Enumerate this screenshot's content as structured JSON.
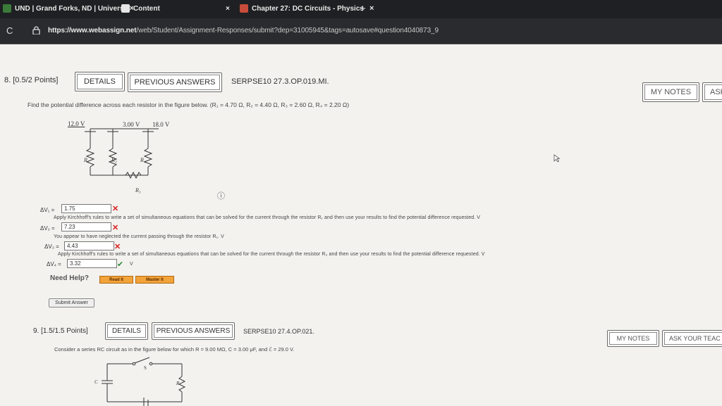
{
  "browser": {
    "tabs": [
      {
        "label": "UND | Grand Forks, ND | Univers",
        "close": "×"
      },
      {
        "label": "Content",
        "close": "×"
      },
      {
        "label": "Chapter 27: DC Circuits - Physics",
        "close": "×"
      }
    ],
    "new_tab": "+",
    "reload": "C",
    "url_host": "https://www.webassign.net",
    "url_path": "/web/Student/Assignment-Responses/submit?dep=31005945&tags=autosave#question4040873_9"
  },
  "q8": {
    "number": "8. [0.5/2 Points]",
    "details": "DETAILS",
    "previous_answers": "PREVIOUS ANSWERS",
    "code": "SERPSE10 27.3.OP.019.MI.",
    "my_notes": "MY NOTES",
    "ask": "ASK",
    "prompt": "Find the potential difference across each resistor in the figure below. (R₁ = 4.70 Ω, R₂ = 4.40 Ω, R₃ = 2.60 Ω, R₄ = 2.20 Ω)",
    "figure": {
      "v1": "12.0 V",
      "v2": "3.00 V",
      "v3": "18.0 V",
      "r1": "R₁",
      "r2": "R₂",
      "r3": "R₃",
      "r4": "R₄"
    },
    "info_icon": "ⓘ",
    "answers": [
      {
        "label": "ΔV₁ =",
        "value": "1.75",
        "status": "✕",
        "hint": "Apply Kirchhoff's rules to write a set of simultaneous equations that can be solved for the current through the resistor R₁ and then use your results to find the potential difference requested. V"
      },
      {
        "label": "ΔV₂ =",
        "value": "7.23",
        "status": "✕",
        "hint": "You appear to have neglected the current passing through the resistor R₁. V"
      },
      {
        "label": "ΔV₃ =",
        "value": "4.43",
        "status": "✕",
        "hint": "Apply Kirchhoff's rules to write a set of simultaneous equations that can be solved for the current through the resistor R₃ and then use your results to find the potential difference requested. V"
      },
      {
        "label": "ΔV₄ =",
        "value": "3.32",
        "status": "✔",
        "hint": "V"
      }
    ],
    "need_help": "Need Help?",
    "read_it": "Read It",
    "master_it": "Master It",
    "submit": "Submit Answer"
  },
  "q9": {
    "number": "9. [1.5/1.5 Points]",
    "details": "DETAILS",
    "previous_answers": "PREVIOUS ANSWERS",
    "code": "SERPSE10 27.4.OP.021.",
    "my_notes": "MY NOTES",
    "ask": "ASK YOUR TEAC",
    "prompt": "Consider a series RC circuit as in the figure below for which R = 9.00 MΩ, C = 3.00 μF, and ℰ = 29.0 V.",
    "figure": {
      "s": "S",
      "c": "C",
      "r": "R"
    }
  },
  "colors": {
    "error": "#d81e1e",
    "correct": "#2e8b3a",
    "accent": "#f2a33a",
    "chrome": "#1f2023"
  }
}
